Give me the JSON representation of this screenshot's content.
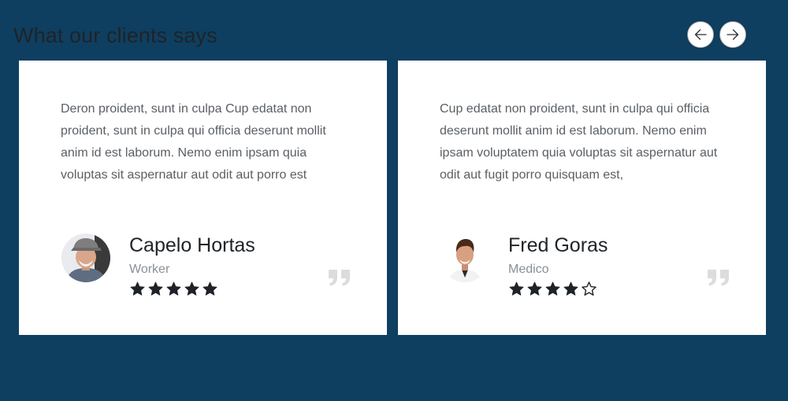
{
  "section": {
    "title": "What our clients says"
  },
  "nav": {
    "prev_icon": "arrow-left-icon",
    "next_icon": "arrow-right-icon"
  },
  "testimonials": [
    {
      "text": "Deron proident, sunt in culpa Cup edatat non proident, sunt in culpa qui officia deserunt mollit anim id est laborum. Nemo enim ipsam quia voluptas sit aspernatur aut odit aut porro est",
      "name": "Capelo Hortas",
      "role": "Worker",
      "rating": 5,
      "max_rating": 5
    },
    {
      "text": "Cup edatat non proident, sunt in culpa qui officia deserunt mollit anim id est laborum. Nemo enim ipsam voluptatem quia voluptas sit aspernatur aut odit aut fugit porro quisquam est,",
      "name": "Fred Goras",
      "role": "Medico",
      "rating": 4,
      "max_rating": 5
    }
  ],
  "colors": {
    "background": "#0e3f60",
    "card": "#ffffff",
    "star": "#1f2328",
    "quote_mark": "#dcdcdc"
  }
}
